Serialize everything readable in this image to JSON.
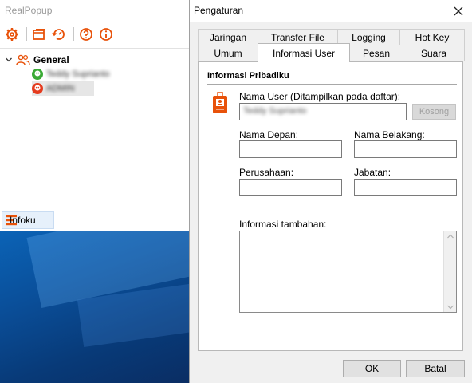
{
  "main_window": {
    "title": "RealPopup",
    "toolbar": {
      "icons": [
        "gear-icon",
        "window-icon",
        "refresh-icon",
        "help-icon",
        "info-icon"
      ]
    },
    "tree": {
      "group_label": "General",
      "users": [
        {
          "name": "Teddy Suprianto",
          "status": "online",
          "color": "#3aaa35"
        },
        {
          "name": "ADMIN",
          "status": "away",
          "color": "#e53b1e"
        }
      ]
    },
    "infoku_label": "Infoku"
  },
  "dialog": {
    "title": "Pengaturan",
    "tabs_row1": [
      "Jaringan",
      "Transfer File",
      "Logging",
      "Hot Key"
    ],
    "tabs_row2": [
      "Umum",
      "Informasi User",
      "Pesan",
      "Suara"
    ],
    "active_tab": "Informasi User",
    "section_title": "Informasi Pribadiku",
    "fields": {
      "username_label": "Nama User (Ditampilkan pada daftar):",
      "username_value": "Teddy Suprianto",
      "clear_button": "Kosong",
      "first_name_label": "Nama Depan:",
      "first_name_value": "",
      "last_name_label": "Nama Belakang:",
      "last_name_value": "",
      "company_label": "Perusahaan:",
      "company_value": "",
      "title_label": "Jabatan:",
      "title_value": "",
      "extra_label": "Informasi tambahan:",
      "extra_value": ""
    },
    "buttons": {
      "ok": "OK",
      "cancel": "Batal"
    }
  },
  "colors": {
    "accent": "#e8520a",
    "online": "#3aaa35",
    "away": "#e53b1e"
  }
}
